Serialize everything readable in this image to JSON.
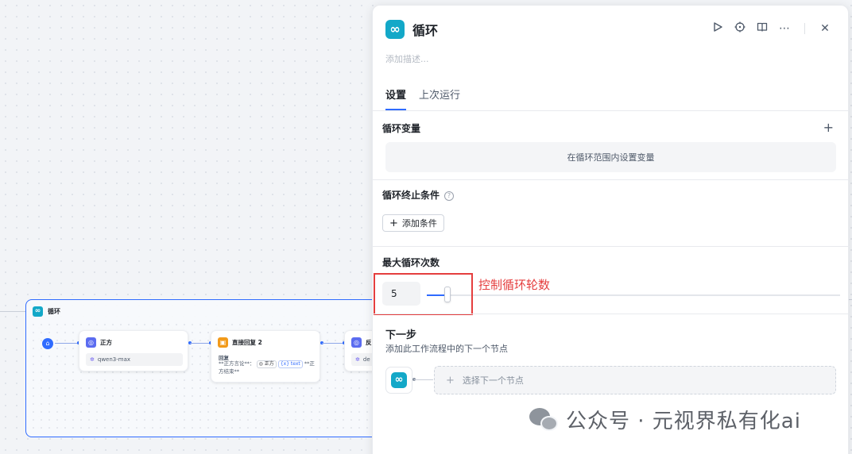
{
  "canvas": {
    "loop_node_title": "循环",
    "nodes": [
      {
        "title": "正方",
        "model": "qwen3-max"
      },
      {
        "title": "直接回复 2",
        "reply_label": "回复",
        "reply_prefix": "**正方言论**：",
        "tag_var": "正方",
        "tag_field": "text",
        "reply_suffix": "**正方结束**"
      },
      {
        "title": "反",
        "model": "de"
      }
    ]
  },
  "panel": {
    "title": "循环",
    "description_placeholder": "添加描述...",
    "tabs": [
      {
        "label": "设置",
        "active": true
      },
      {
        "label": "上次运行",
        "active": false
      }
    ],
    "loop_variables": {
      "label": "循环变量",
      "empty_text": "在循环范围内设置变量"
    },
    "stop_condition": {
      "label": "循环终止条件",
      "add_button": "添加条件"
    },
    "max_loops": {
      "label": "最大循环次数",
      "value": "5",
      "slider_fraction": 0.05,
      "annotation": "控制循环轮数"
    },
    "next_step": {
      "title": "下一步",
      "subtitle": "添加此工作流程中的下一个节点",
      "select_label": "选择下一个节点"
    }
  },
  "watermark": {
    "text": "公众号 · 元视界私有化ai"
  },
  "colors": {
    "accent": "#2f6bff",
    "loop_icon": "#13a8c8",
    "annotation_red": "#e53e3e"
  }
}
